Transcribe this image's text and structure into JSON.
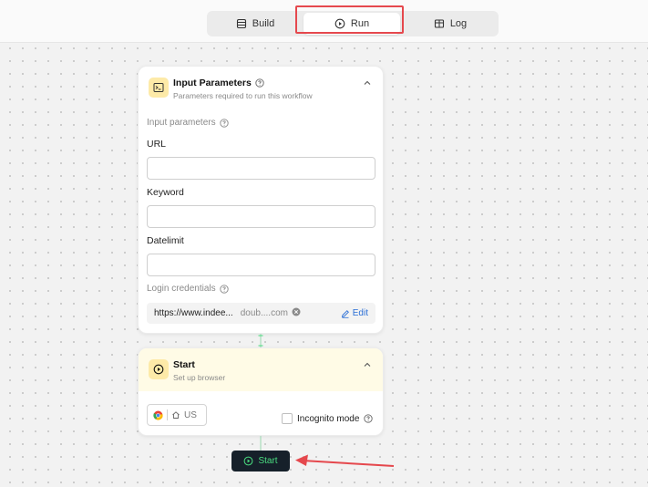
{
  "tabs": {
    "build": "Build",
    "run": "Run",
    "log": "Log"
  },
  "input_card": {
    "title": "Input Parameters",
    "subtitle": "Parameters required to run this workflow",
    "section_label": "Input parameters",
    "fields": [
      {
        "label": "URL",
        "value": ""
      },
      {
        "label": "Keyword",
        "value": ""
      },
      {
        "label": "Datelimit",
        "value": ""
      }
    ],
    "credentials_label": "Login credentials",
    "credential_url": "https://www.indee...",
    "credential_user": "doub....com",
    "edit_label": "Edit"
  },
  "start_card": {
    "title": "Start",
    "subtitle": "Set up browser",
    "region": "US",
    "incognito_label": "Incognito mode",
    "incognito_checked": false
  },
  "start_button": "Start",
  "colors": {
    "highlight": "#e5484d",
    "accent_green": "#4ade80",
    "link_blue": "#2b6fd6",
    "header_icon_bg": "#fdeaa8"
  },
  "icons": [
    "build-icon",
    "play-circle-icon",
    "log-icon",
    "terminal-icon",
    "help-circle-icon",
    "chevron-up-icon",
    "clear-icon",
    "pencil-icon",
    "chrome-icon",
    "home-icon"
  ]
}
